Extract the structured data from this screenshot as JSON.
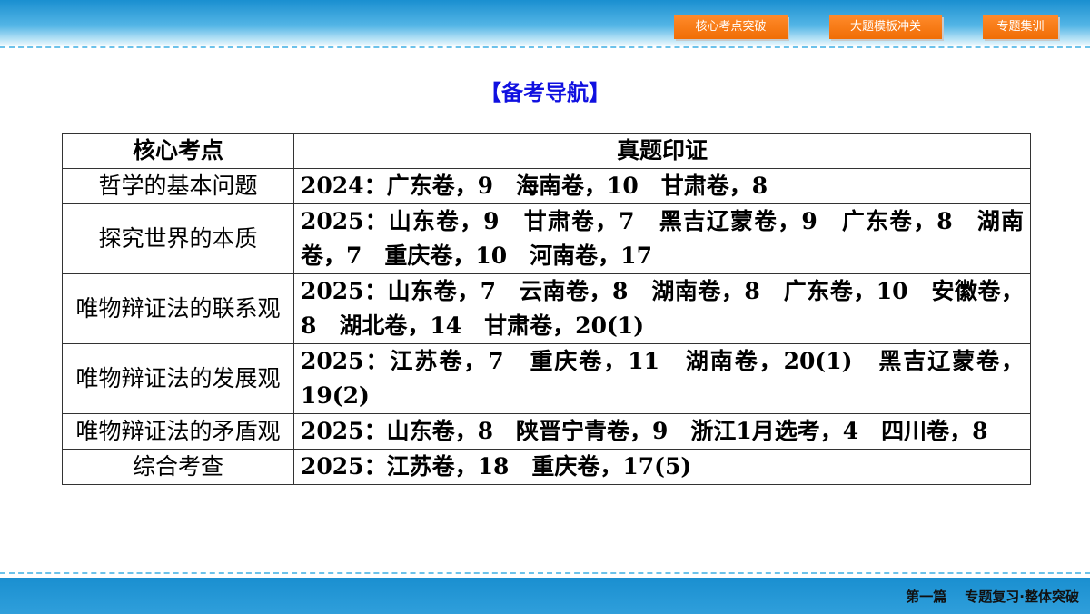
{
  "nav": {
    "buttons": [
      "核心考点突破",
      "大题模板冲关",
      "专题集训"
    ]
  },
  "guide": {
    "title": "【备考导航】"
  },
  "table": {
    "headers": [
      "核心考点",
      "真题印证"
    ],
    "rows": [
      {
        "point": "哲学的基本问题",
        "evidence": "2024：广东卷，9　海南卷，10　甘肃卷，8"
      },
      {
        "point": "探究世界的本质",
        "evidence": "2025：山东卷，9　甘肃卷，7　黑吉辽蒙卷，9　广东卷，8　湖南卷，7　重庆卷，10　河南卷，17"
      },
      {
        "point": "唯物辩证法的联系观",
        "evidence": "2025：山东卷，7　云南卷，8　湖南卷，8　广东卷，10　安徽卷，8　湖北卷，14　甘肃卷，20(1)"
      },
      {
        "point": "唯物辩证法的发展观",
        "evidence": "2025：江苏卷，7　重庆卷，11　湖南卷，20(1)　黑吉辽蒙卷，19(2)"
      },
      {
        "point": "唯物辩证法的矛盾观",
        "evidence": "2025：山东卷，8　陕晋宁青卷，9　浙江1月选考，4　四川卷，8"
      },
      {
        "point": "综合考查",
        "evidence": "2025：江苏卷，18　重庆卷，17(5)"
      }
    ]
  },
  "footer": {
    "part": "第一篇",
    "section": "专题复习·整体突破"
  },
  "colors": {
    "nav_button": "#f06d05",
    "band": "#1a8fd0",
    "title": "#1010e0"
  }
}
